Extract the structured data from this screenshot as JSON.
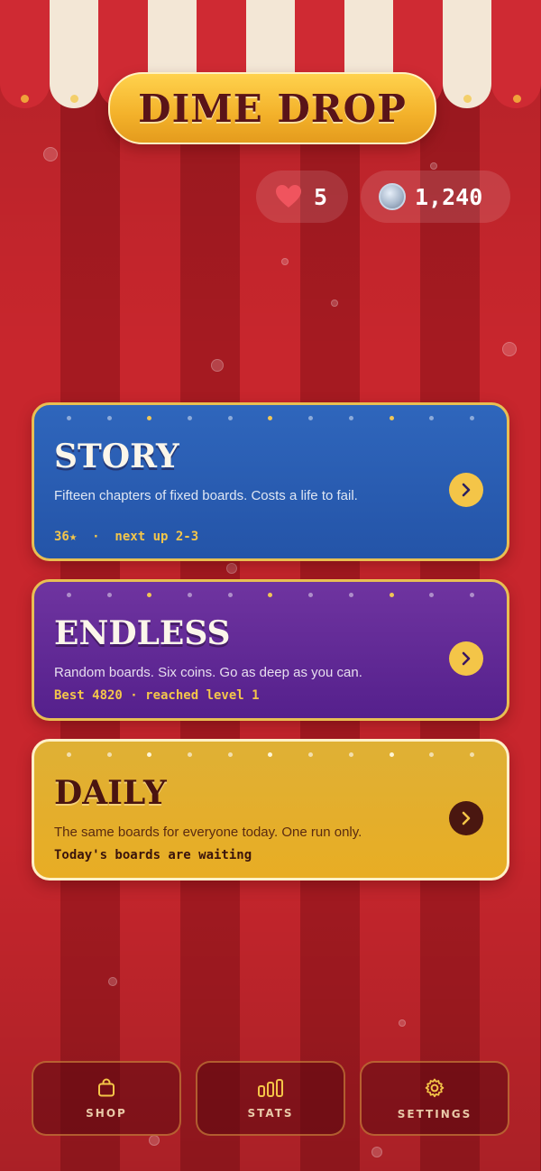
{
  "app": {
    "title": "DIME DROP"
  },
  "status": {
    "lives": "5",
    "coins": "1,240",
    "lives_icon": "heart-icon",
    "coins_icon": "coin-icon"
  },
  "modes": [
    {
      "id": "story",
      "title": "STORY",
      "description": "Fifteen chapters of fixed boards. Costs a life to fail.",
      "meta": "36★  ·  next up 2-3",
      "color": "#2a5db3"
    },
    {
      "id": "endless",
      "title": "ENDLESS",
      "description": "Random boards. Six coins. Go as deep as you can.",
      "meta": "Best 4820 · reached level 1",
      "color": "#5e2894"
    },
    {
      "id": "daily",
      "title": "DAILY",
      "description": "The same boards for everyone today. One run only.",
      "meta": "Today's boards are waiting",
      "color": "#e2ae2c"
    }
  ],
  "nav": {
    "shop": "SHOP",
    "stats": "STATS",
    "settings": "SETTINGS"
  },
  "colors": {
    "stripe_light": "#c8262d",
    "stripe_dark": "#a51a21",
    "accent_gold": "#f4c548",
    "title_text": "#5a1418"
  }
}
